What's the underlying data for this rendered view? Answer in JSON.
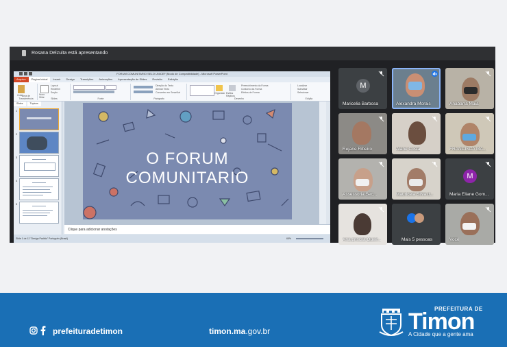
{
  "meeting": {
    "presenter_text": "Rosana Delzuita está apresentando"
  },
  "powerpoint": {
    "window_title": "FORUM COMUNITARIO SELO UNICEF [Modo de Compatibilidade] - Microsoft PowerPoint",
    "tabs": [
      "Arquivo",
      "Página Inicial",
      "Inserir",
      "Design",
      "Transições",
      "Animações",
      "Apresentação de Slides",
      "Revisão",
      "Exibição"
    ],
    "ribbon_groups": [
      "Área de Transferência",
      "Slides",
      "Fonte",
      "Parágrafo",
      "Desenho",
      "Edição"
    ],
    "ribbon_items": [
      "Colar",
      "Novo Slide",
      "Layout",
      "Redefinir",
      "Seção",
      "Direção do Texto",
      "Alinhar Texto",
      "Converter em SmartArt",
      "Organizar",
      "Estilos Rápidos",
      "Preenchimento da Forma",
      "Contorno da Forma",
      "Efeitos de Forma",
      "Localizar",
      "Substituir",
      "Selecionar"
    ],
    "left_tabs": [
      "Slides",
      "Tópicos"
    ],
    "slide_title": "O FORUM COMUNITARIO",
    "notes_placeholder": "Clique para adicionar anotações",
    "status_text": "Slide 1 de 12   \"Design Padrão\"   Português (Brasil)",
    "zoom": "65%"
  },
  "participants": [
    {
      "name": "Maricelia Barbosa",
      "avatar_letter": "M",
      "avatar_color": "#5f6368",
      "muted": true
    },
    {
      "name": "Alexandra Morais",
      "speaking": true
    },
    {
      "name": "Anabarra Maia",
      "muted": true
    },
    {
      "name": "Rejane Ribeiro",
      "muted": true
    },
    {
      "name": "Alane Costa",
      "muted": true
    },
    {
      "name": "FRANCISCA MA...",
      "muted": true
    },
    {
      "name": "Assessoria Sec...",
      "muted": true
    },
    {
      "name": "Mauriceia Silva d...",
      "muted": true
    },
    {
      "name": "Maria Eliane Gom...",
      "avatar_letter": "M",
      "avatar_color": "#8e24aa",
      "muted": true
    },
    {
      "name": "Ana priscila Queir...",
      "muted": true
    },
    {
      "name": "Mais 5 pessoas"
    },
    {
      "name": "Você",
      "muted": true
    }
  ],
  "footer": {
    "social_handle": "prefeituradetimon",
    "site_bold": "timon.ma",
    "site_rest": ".gov.br",
    "brand_prefix": "PREFEITURA DE",
    "brand_name": "Timon",
    "brand_slogan": "A Cidade que a gente ama"
  },
  "colors": {
    "meet_bg": "#202124",
    "tile_bg": "#3c4043",
    "footer_blue": "#1a6fb5",
    "slide_bg": "#7b8ab0",
    "speaking_border": "#8ab4f8"
  }
}
